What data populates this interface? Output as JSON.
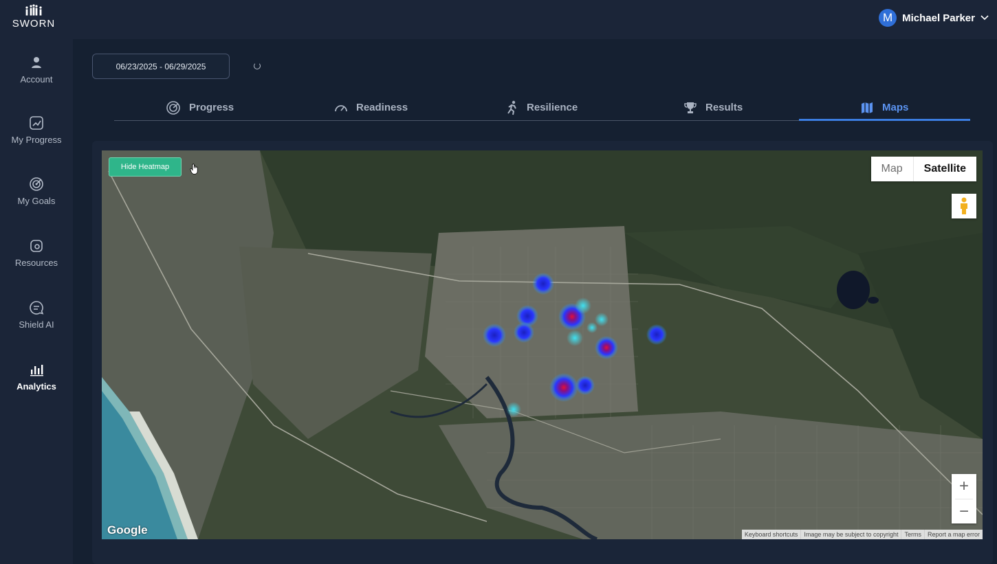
{
  "brand": {
    "name": "SWORN",
    "icon": "sworn-logo-icon"
  },
  "user": {
    "initial": "M",
    "name": "Michael Parker",
    "avatar_color": "#2f6fd8"
  },
  "sidebar": {
    "items": [
      {
        "label": "Account",
        "icon": "person-icon",
        "active": false
      },
      {
        "label": "My Progress",
        "icon": "chart-up-icon",
        "active": false
      },
      {
        "label": "My Goals",
        "icon": "target-icon",
        "active": false
      },
      {
        "label": "Resources",
        "icon": "resources-icon",
        "active": false
      },
      {
        "label": "Shield AI",
        "icon": "chat-icon",
        "active": false
      },
      {
        "label": "Analytics",
        "icon": "bar-chart-icon",
        "active": true
      }
    ]
  },
  "filters": {
    "date_range": "06/23/2025 - 06/29/2025"
  },
  "tabs": [
    {
      "label": "Progress",
      "icon": "radar-icon",
      "active": false
    },
    {
      "label": "Readiness",
      "icon": "gauge-icon",
      "active": false
    },
    {
      "label": "Resilience",
      "icon": "runner-icon",
      "active": false
    },
    {
      "label": "Results",
      "icon": "trophy-icon",
      "active": false
    },
    {
      "label": "Maps",
      "icon": "map-icon",
      "active": true
    }
  ],
  "map": {
    "heatmap_button": "Hide Heatmap",
    "map_type": {
      "map": "Map",
      "satellite": "Satellite",
      "selected": "Satellite"
    },
    "zoom": {
      "in": "+",
      "out": "−"
    },
    "provider": "Google",
    "attribution": [
      "Keyboard shortcuts",
      "Image may be subject to copyright",
      "Terms",
      "Report a map error"
    ]
  },
  "colors": {
    "accent": "#3b7de0",
    "heatmap_button": "#2fb58a",
    "background": "#152031"
  }
}
